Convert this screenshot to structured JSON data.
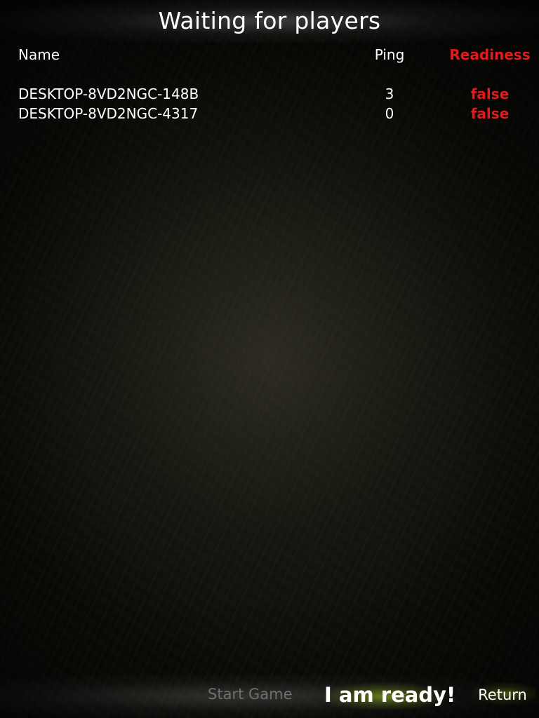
{
  "title": "Waiting for players",
  "table": {
    "headers": {
      "name": "Name",
      "ping": "Ping",
      "readiness": "Readiness"
    },
    "rows": [
      {
        "name": "DESKTOP-8VD2NGC-148B",
        "ping": "3",
        "readiness": "false"
      },
      {
        "name": "DESKTOP-8VD2NGC-4317",
        "ping": "0",
        "readiness": "false"
      }
    ]
  },
  "buttons": {
    "start_game": "Start Game",
    "ready": "I am ready!",
    "return": "Return"
  },
  "colors": {
    "readiness_false": "#e31b1b",
    "disabled_button": "#6f6f6f",
    "ready_button_glow": "#788c1e"
  }
}
